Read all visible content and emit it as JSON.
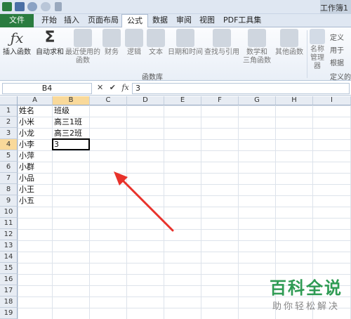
{
  "titlebar": {
    "app_title": "工作簿1"
  },
  "tabs": [
    {
      "label": "文件"
    },
    {
      "label": "开始"
    },
    {
      "label": "插入"
    },
    {
      "label": "页面布局"
    },
    {
      "label": "公式"
    },
    {
      "label": "数据"
    },
    {
      "label": "审阅"
    },
    {
      "label": "视图"
    },
    {
      "label": "PDF工具集"
    }
  ],
  "ribbon": {
    "insert_function": "插入函数",
    "autosum": "自动求和",
    "recent_line1": "最近使用的",
    "recent_line2": "函数",
    "finance": "财务",
    "logic": "逻辑",
    "text": "文本",
    "datetime": "日期和时间",
    "lookup": "查找与引用",
    "math_line1": "数学和",
    "math_line2": "三角函数",
    "other": "其他函数",
    "name_mgr_line1": "名称",
    "name_mgr_line2": "管理器",
    "define_name": "定义",
    "use_in_formula": "用于",
    "create_from_sel": "根据",
    "group_label": "函数库",
    "group_label_defined": "定义的"
  },
  "formula_bar": {
    "name_box": "B4",
    "cancel": "✕",
    "enter": "✔",
    "fx": "fx",
    "value": "3"
  },
  "columns": [
    "A",
    "B",
    "C",
    "D",
    "E",
    "F",
    "G",
    "H",
    "I"
  ],
  "rows": [
    "1",
    "2",
    "3",
    "4",
    "5",
    "6",
    "7",
    "8",
    "9",
    "10",
    "11",
    "12",
    "13",
    "14",
    "15",
    "16",
    "17",
    "18",
    "19"
  ],
  "cells": {
    "A1": "姓名",
    "B1": "班级",
    "A2": "小米",
    "B2": "高三1班",
    "A3": "小龙",
    "B3": "高三2班",
    "A4": "小李",
    "B4": "3",
    "A5": "小萍",
    "A6": "小群",
    "A7": "小品",
    "A8": "小王",
    "A9": "小五"
  },
  "active_cell": "B4",
  "watermark": {
    "main": "百科全说",
    "sub": "助你轻松解决"
  },
  "colors": {
    "file_tab": "#2a7c3f",
    "selection_header": "#f9d99a",
    "arrow": "#e8322b",
    "watermark": "#2f9b54"
  }
}
